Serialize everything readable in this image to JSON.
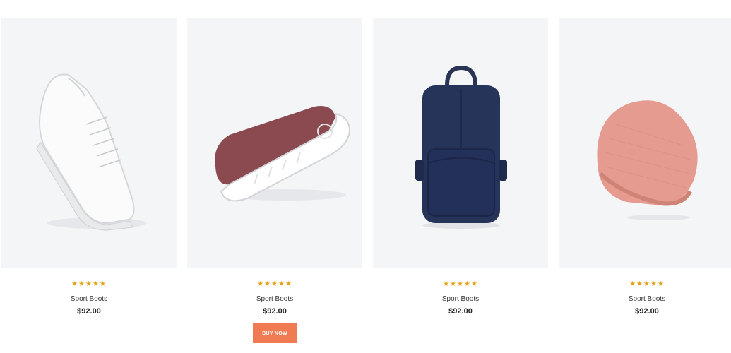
{
  "products": [
    {
      "name": "Sport Boots",
      "price": "$92.00",
      "rating": "★★★★★",
      "image": "white-sneaker"
    },
    {
      "name": "Sport Boots",
      "price": "$92.00",
      "rating": "★★★★★",
      "image": "maroon-shoe-sole",
      "button": "BUY NOW"
    },
    {
      "name": "Sport Boots",
      "price": "$92.00",
      "rating": "★★★★★",
      "image": "navy-backpack"
    },
    {
      "name": "Sport Boots",
      "price": "$92.00",
      "rating": "★★★★★",
      "image": "pink-beanie"
    }
  ],
  "colors": {
    "star": "#e6a117",
    "button": "#f07b52",
    "image_bg": "#f4f5f7"
  }
}
